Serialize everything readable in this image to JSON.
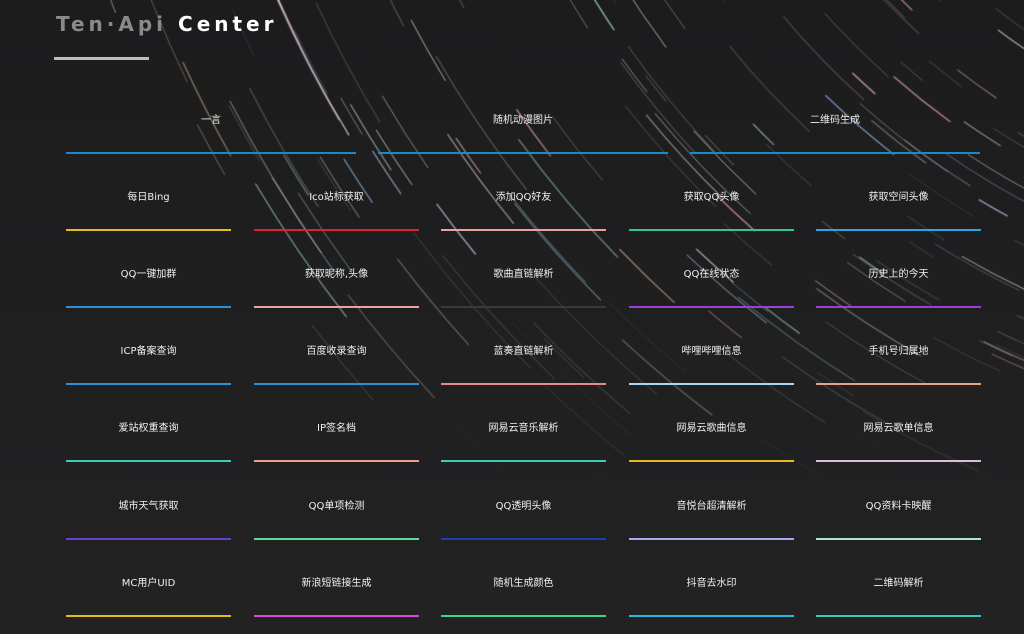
{
  "header": {
    "title_part1": "Ten·Api",
    "title_part2": "Center"
  },
  "top_row": [
    {
      "label": "一言",
      "color": "#1e88c8"
    },
    {
      "label": "随机动漫图片",
      "color": "#1e88c8"
    },
    {
      "label": "二维码生成",
      "color": "#1e88c8"
    }
  ],
  "grid": [
    [
      {
        "label": "每日Bing",
        "color": "#e6b91e"
      },
      {
        "label": "Ico站标获取",
        "color": "#d9232e"
      },
      {
        "label": "添加QQ好友",
        "color": "#e8a39b"
      },
      {
        "label": "获取QQ头像",
        "color": "#35c48a"
      },
      {
        "label": "获取空间头像",
        "color": "#2aa5e0"
      }
    ],
    [
      {
        "label": "QQ一键加群",
        "color": "#2e8fd6"
      },
      {
        "label": "获取昵称,头像",
        "color": "#e8a39b"
      },
      {
        "label": "歌曲直链解析",
        "color": "#3a3a3a"
      },
      {
        "label": "QQ在线状态",
        "color": "#9b3fd8"
      },
      {
        "label": "历史上的今天",
        "color": "#9b3fd8"
      }
    ],
    [
      {
        "label": "ICP备案查询",
        "color": "#2e8fd6"
      },
      {
        "label": "百度收录查询",
        "color": "#2e8fd6"
      },
      {
        "label": "蓝奏直链解析",
        "color": "#e88a8a"
      },
      {
        "label": "哔哩哔哩信息",
        "color": "#a5d7f0"
      },
      {
        "label": "手机号归属地",
        "color": "#e8a08a"
      }
    ],
    [
      {
        "label": "爱站权重查询",
        "color": "#3ec9b8"
      },
      {
        "label": "IP签名档",
        "color": "#e8a08a"
      },
      {
        "label": "网易云音乐解析",
        "color": "#3ec9b8"
      },
      {
        "label": "网易云歌曲信息",
        "color": "#e6b91e"
      },
      {
        "label": "网易云歌单信息",
        "color": "#d9c0d8"
      }
    ],
    [
      {
        "label": "城市天气获取",
        "color": "#6a3fd0"
      },
      {
        "label": "QQ单项检测",
        "color": "#5fd89a"
      },
      {
        "label": "QQ透明头像",
        "color": "#1e3fb0"
      },
      {
        "label": "音悦台超清解析",
        "color": "#a0a8f0"
      },
      {
        "label": "QQ资料卡映醒",
        "color": "#a8e8c8"
      }
    ],
    [
      {
        "label": "MC用户UID",
        "color": "#e6b91e"
      },
      {
        "label": "新浪短链接生成",
        "color": "#d94ad8"
      },
      {
        "label": "随机生成颜色",
        "color": "#35d88a"
      },
      {
        "label": "抖音去水印",
        "color": "#2ab8e0"
      },
      {
        "label": "二维码解析",
        "color": "#35c8c0"
      }
    ]
  ]
}
